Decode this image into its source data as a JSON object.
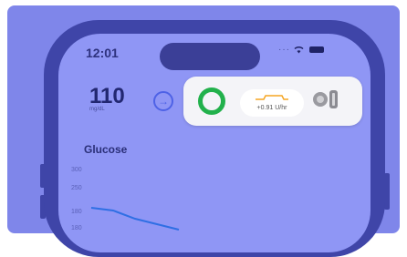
{
  "status_bar": {
    "time": "12:01"
  },
  "glucose_reading": {
    "value": "110",
    "unit": "mg/dL",
    "trend_icon": "arrow-right-icon"
  },
  "live_activity": {
    "ring_color": "#22b14c",
    "delta_label": "+0.91 U/hr",
    "line_color": "#f5a623",
    "device_icon": "pump-pod-icon"
  },
  "chart": {
    "title": "Glucose",
    "y_ticks": [
      "300",
      "250",
      "180",
      "180"
    ],
    "line_color": "#2f6fe4"
  },
  "chart_data": {
    "type": "line",
    "title": "Glucose",
    "xlabel": "",
    "ylabel": "",
    "y_ticks": [
      "300",
      "250",
      "180",
      "180"
    ],
    "series": [
      {
        "values": [
          180,
          175,
          160,
          150,
          140
        ]
      }
    ]
  }
}
